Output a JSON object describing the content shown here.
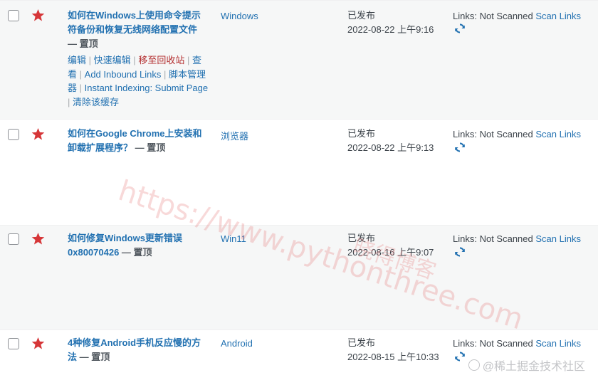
{
  "rows": [
    {
      "title": "如何在Windows上使用命令提示符备份和恢复无线网络配置文件",
      "state": " — 置顶",
      "category": "Windows",
      "status": "已发布",
      "date": "2022-08-22 上午9:16",
      "links_label": "Links: Not Scanned",
      "scan_label": "Scan Links"
    },
    {
      "title": "如何在Google Chrome上安装和卸载扩展程序？",
      "state": " — 置顶",
      "category": "浏览器",
      "status": "已发布",
      "date": "2022-08-22 上午9:13",
      "links_label": "Links: Not Scanned",
      "scan_label": "Scan Links"
    },
    {
      "title": "如何修复Windows更新错误0x80070426",
      "state": " — 置顶",
      "category": "Win11",
      "status": "已发布",
      "date": "2022-08-16 上午9:07",
      "links_label": "Links: Not Scanned",
      "scan_label": "Scan Links"
    },
    {
      "title": "4种修复Android手机反应慢的方法",
      "state": " — 置顶",
      "category": "Android",
      "status": "已发布",
      "date": "2022-08-15 上午10:33",
      "links_label": "Links: Not Scanned",
      "scan_label": "Scan Links"
    }
  ],
  "row_actions": {
    "edit": "编辑",
    "quick_edit": "快速编辑",
    "trash": "移至回收站",
    "view": "查看",
    "add_inbound": "Add Inbound Links",
    "script_manager": "脚本管理器",
    "instant_indexing": "Instant Indexing: Submit Page",
    "clear_cache": "清除该缓存"
  },
  "icons": {
    "featured": "star-icon",
    "refresh": "refresh-icon",
    "checkbox": "checkbox"
  },
  "colors": {
    "link": "#2271b1",
    "trash": "#b32d2e",
    "star": "#d63638",
    "alt_row": "#f6f7f7"
  },
  "watermark": {
    "text": "https://www.pythonthree.com",
    "text2": "晓得博客",
    "corner": "@稀土掘金技术社区"
  }
}
